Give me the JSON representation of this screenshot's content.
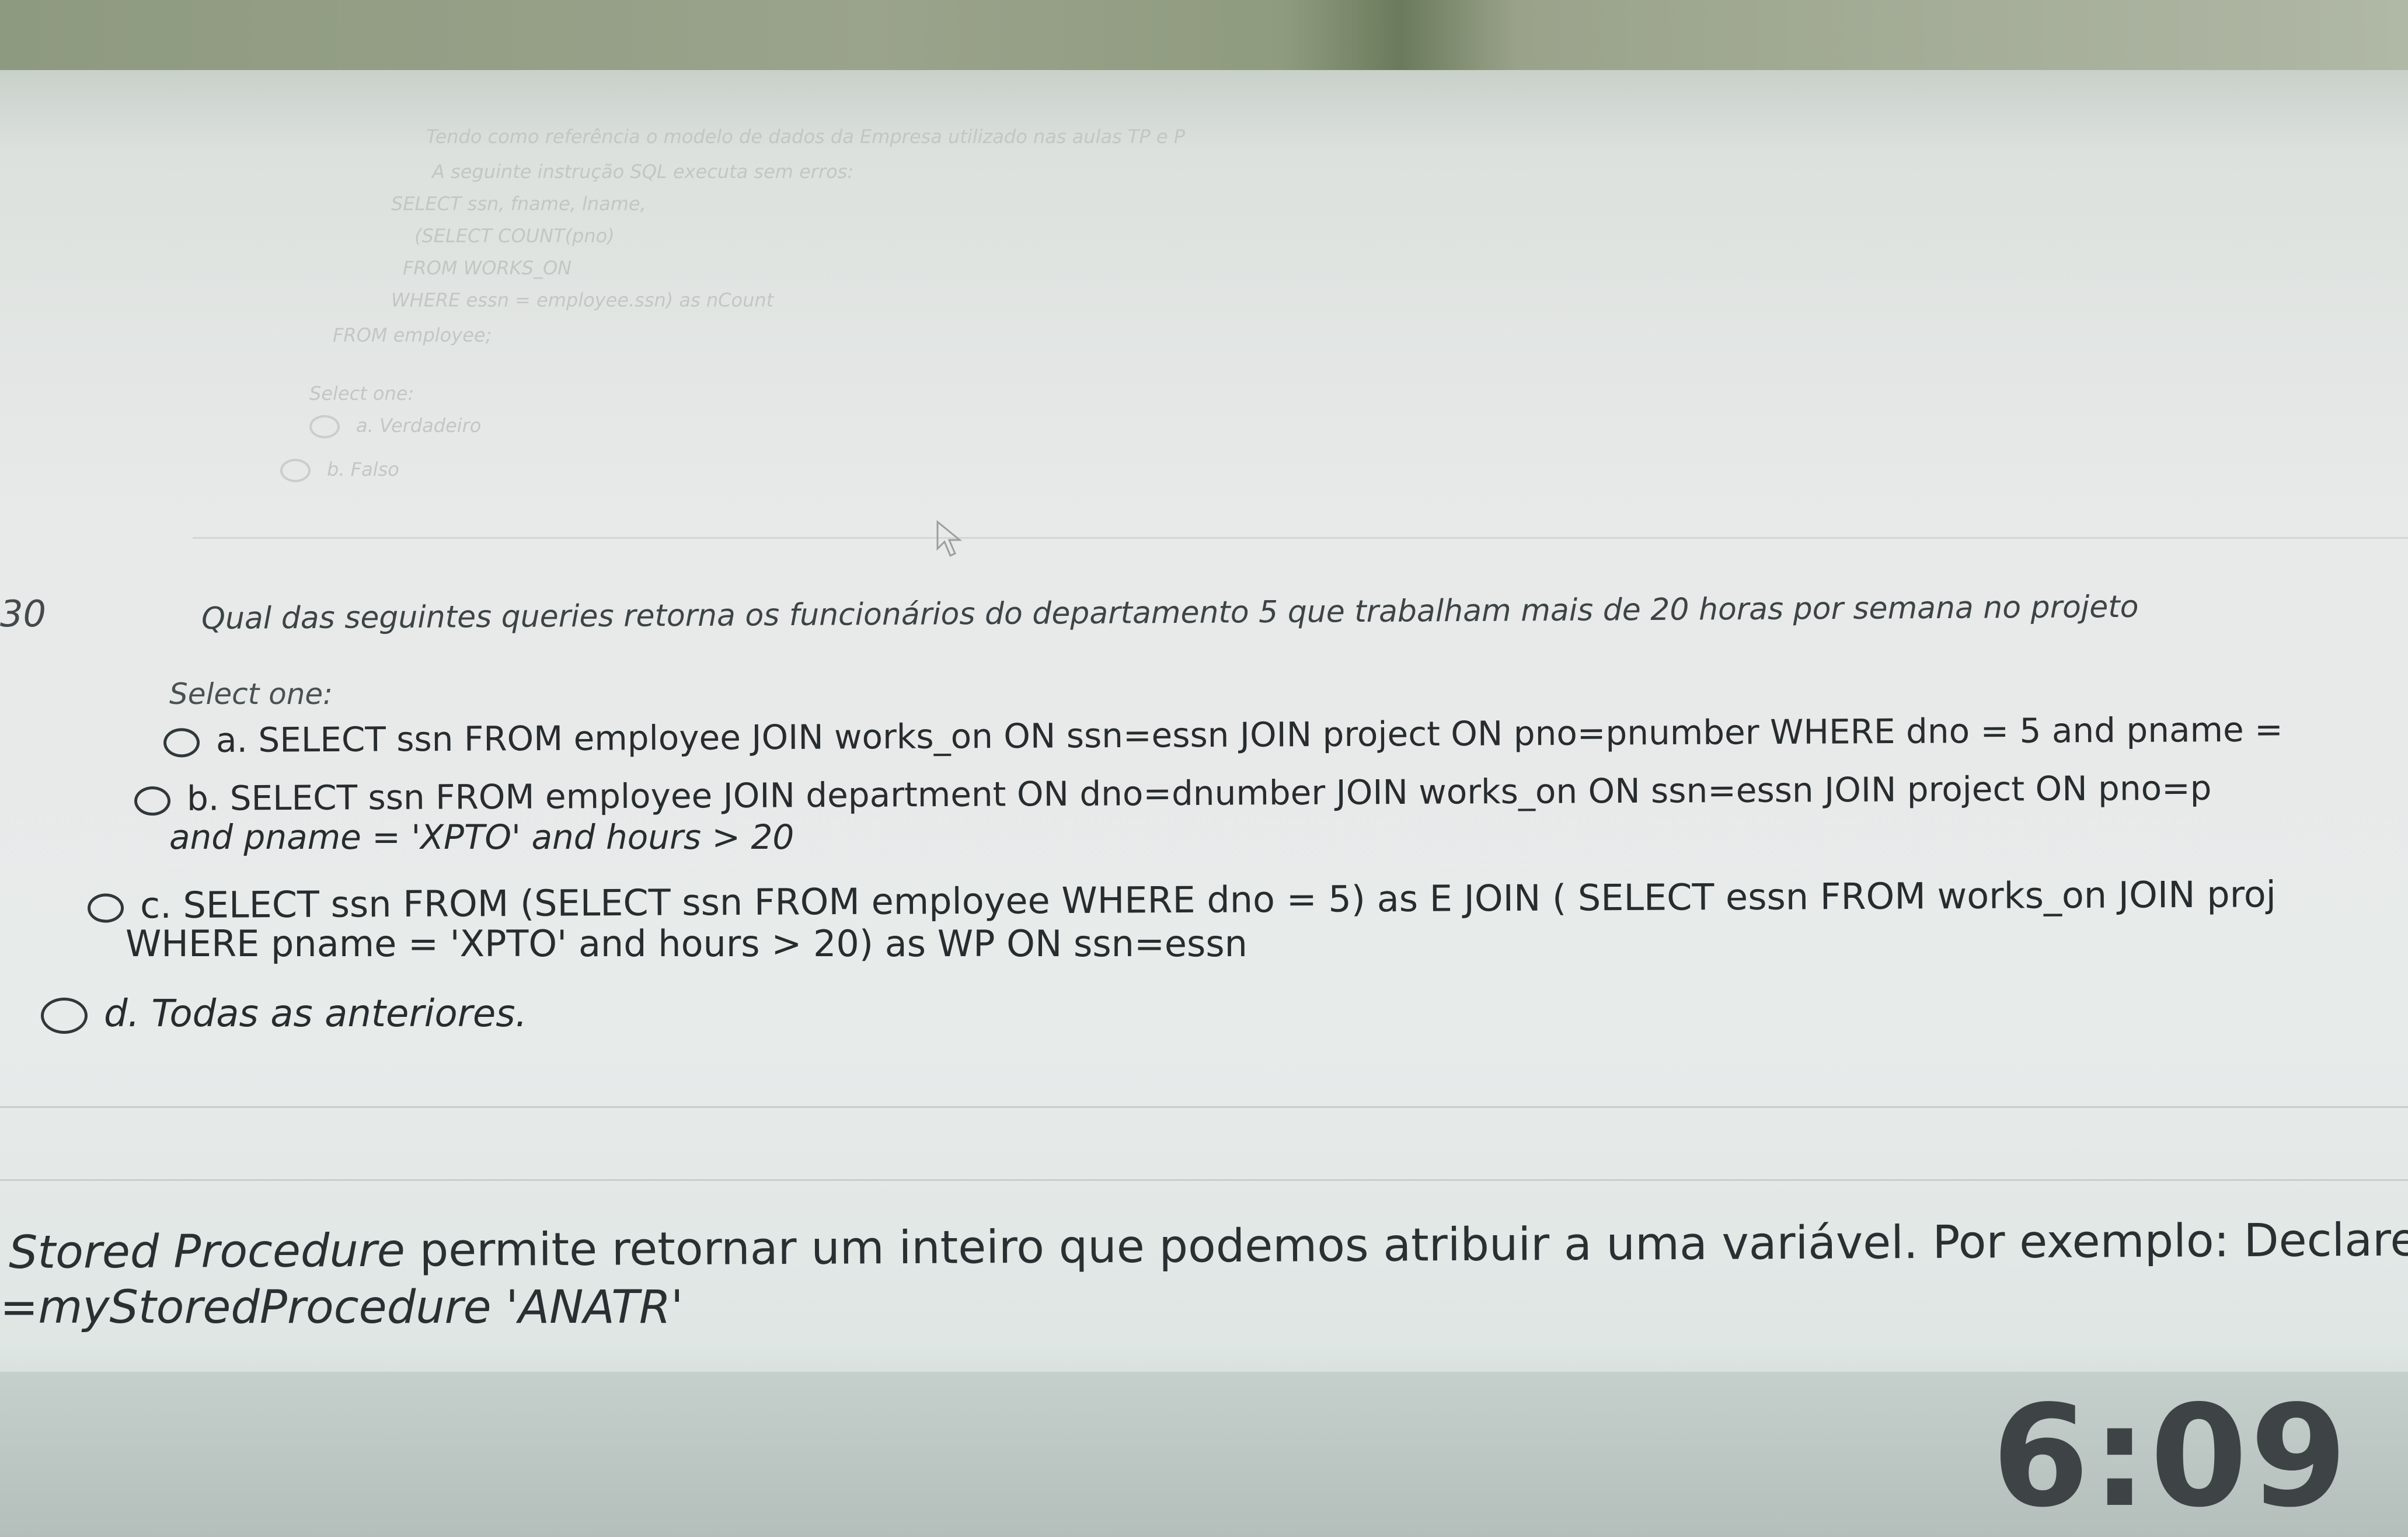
{
  "previous_question": {
    "lines": [
      "Tendo como referência o modelo de dados da Empresa utilizado nas aulas TP e P",
      "A seguinte instrução SQL executa sem erros:",
      "SELECT ssn, fname, lname,",
      "(SELECT COUNT(pno)",
      "FROM WORKS_ON",
      "WHERE essn = employee.ssn) as nCount",
      "FROM employee;"
    ],
    "select_one": "Select one:",
    "options": [
      "a. Verdadeiro",
      "b. Falso"
    ]
  },
  "question": {
    "number": "30",
    "text": "Qual das seguintes queries retorna os funcionários do departamento 5 que trabalham mais de 20 horas por semana no projeto",
    "select_one": "Select one:",
    "options": [
      {
        "line1": "a. SELECT ssn FROM employee JOIN works_on ON ssn=essn JOIN project ON pno=pnumber WHERE dno = 5 and pname ="
      },
      {
        "line1": "b. SELECT ssn FROM employee JOIN department ON dno=dnumber JOIN works_on ON ssn=essn JOIN project ON pno=p",
        "line2": "and pname = 'XPTO' and hours > 20"
      },
      {
        "line1": "c. SELECT ssn FROM (SELECT ssn FROM employee WHERE dno = 5) as E JOIN ( SELECT essn FROM works_on JOIN proj",
        "line2": "WHERE pname = 'XPTO' and hours > 20) as WP ON ssn=essn"
      },
      {
        "line1": "d. Todas as anteriores."
      }
    ]
  },
  "next_question": {
    "line1_italic": "Stored Procedure",
    "line1_rest": " permite retornar um inteiro que podemos atribuir a uma variável. Por exemplo: Declare @",
    "line2": "=myStoredProcedure 'ANATR'"
  },
  "clock": "6:09"
}
